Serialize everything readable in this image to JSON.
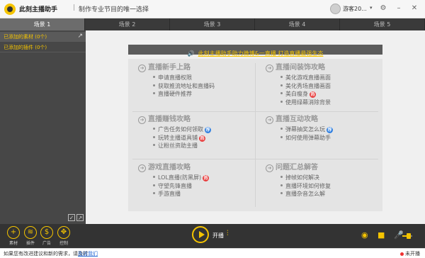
{
  "titlebar": {
    "app_name": "此刻主播助手",
    "separator": "|",
    "slogan": "制作专业节目的唯一选择",
    "user_name": "游客20...",
    "user_caret": "▾"
  },
  "scenes": [
    "场景 1",
    "场景 2",
    "场景 3",
    "场景 4",
    "场景 5"
  ],
  "active_scene_index": 0,
  "sources": {
    "added_materials": "已添加的素材 (0个)",
    "added_plugins": "已添加的插件 (0个)"
  },
  "banner": {
    "text": "此刻主播助手助力微博&一直播 打造直播最强生态"
  },
  "guide": {
    "sections": [
      {
        "title": "直播新手上路",
        "items": [
          {
            "text": "申请直播权限"
          },
          {
            "text": "获取推流地址和直播码"
          },
          {
            "text": "直播硬件推荐"
          }
        ]
      },
      {
        "title": "直播间装饰攻略",
        "items": [
          {
            "text": "美化游戏直播画面"
          },
          {
            "text": "美化秀场直播画面"
          },
          {
            "text": "美白瘦身",
            "badge": "热"
          },
          {
            "text": "使用绿幕消除背景"
          }
        ]
      },
      {
        "title": "直播赚钱攻略",
        "items": [
          {
            "text": "广告任务如何领取",
            "badge": "荐"
          },
          {
            "text": "玩转主播道具铺",
            "badge": "热"
          },
          {
            "text": "让粉丝资助主播"
          }
        ]
      },
      {
        "title": "直播互动攻略",
        "items": [
          {
            "text": "弹幕抽奖怎么玩",
            "badge": "荐"
          },
          {
            "text": "如何使用弹幕助手"
          }
        ]
      },
      {
        "title": "游戏直播攻略",
        "items": [
          {
            "text": "LOL直播(防黑屏)",
            "badge": "热"
          },
          {
            "text": "守望先锋直播"
          },
          {
            "text": "手游直播"
          }
        ]
      },
      {
        "title": "问题汇总解答",
        "items": [
          {
            "text": "掉帧如何解决"
          },
          {
            "text": "直播环境如何修复"
          },
          {
            "text": "直播杂音怎么解"
          }
        ]
      }
    ]
  },
  "toolbar": {
    "materials_label": "素材",
    "plugins_label": "插件",
    "ads_label": "广告",
    "control_label": "控制",
    "live_label": "开播"
  },
  "status": {
    "message": "如果您有改进建议和新的需求，请及时",
    "link": "告诉我们",
    "live_state": "未开播"
  },
  "colors": {
    "accent": "#f5c400",
    "badge_hot": "#e83a3a",
    "badge_recommend": "#2f7fe0",
    "dark_bg": "#333333"
  },
  "icons": [
    "logo-icon",
    "settings-icon",
    "minimize-icon",
    "close-icon",
    "speaker-icon",
    "add-icon",
    "layers-icon",
    "dollar-icon",
    "move-icon",
    "play-icon",
    "mixer-icon",
    "webcam-icon",
    "camera-icon",
    "mic-icon"
  ]
}
